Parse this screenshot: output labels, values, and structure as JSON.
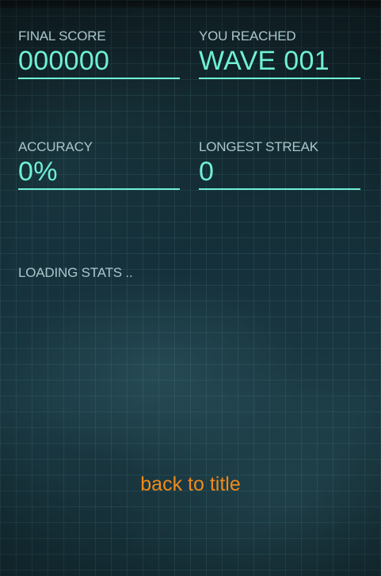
{
  "stats": {
    "final_score": {
      "label": "FINAL SCORE",
      "value": "000000"
    },
    "wave": {
      "label": "YOU REACHED",
      "value": "WAVE 001"
    },
    "accuracy": {
      "label": "ACCURACY",
      "value": "0%"
    },
    "streak": {
      "label": "LONGEST STREAK",
      "value": "0"
    }
  },
  "loading_text": "LOADING STATS ..",
  "back_link_label": "back to title",
  "colors": {
    "accent": "#6ff0d4",
    "label": "#a9c6cb",
    "link": "#f08a1a",
    "background": "#15303a"
  }
}
